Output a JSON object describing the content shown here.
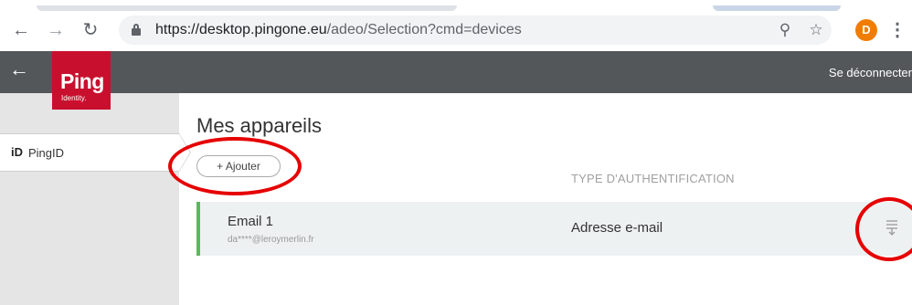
{
  "browser": {
    "back_icon": "arrow-left-icon",
    "forward_icon": "arrow-right-icon",
    "reload_icon": "reload-icon",
    "url_host": "https://desktop.pingone.eu",
    "url_path": "/adeo/Selection?cmd=devices",
    "profile_initial": "D",
    "profile_color": "#f07d00"
  },
  "header": {
    "logo_text": "Ping",
    "logo_subtext": "Identity.",
    "logout_label": "Se déconnecter",
    "brand_color": "#c8102e",
    "bar_color": "#53575a"
  },
  "sidebar": {
    "items": [
      {
        "icon_text": "iD",
        "label": "PingID"
      }
    ]
  },
  "main": {
    "title": "Mes appareils",
    "add_button_label": "+ Ajouter",
    "column_header": "TYPE D'AUTHENTIFICATION",
    "devices": [
      {
        "name": "Email 1",
        "identifier": "da****@leroymerlin.fr",
        "type": "Adresse e-mail",
        "status_color": "#5cb85c"
      }
    ]
  },
  "annotation_color": "#e60000"
}
